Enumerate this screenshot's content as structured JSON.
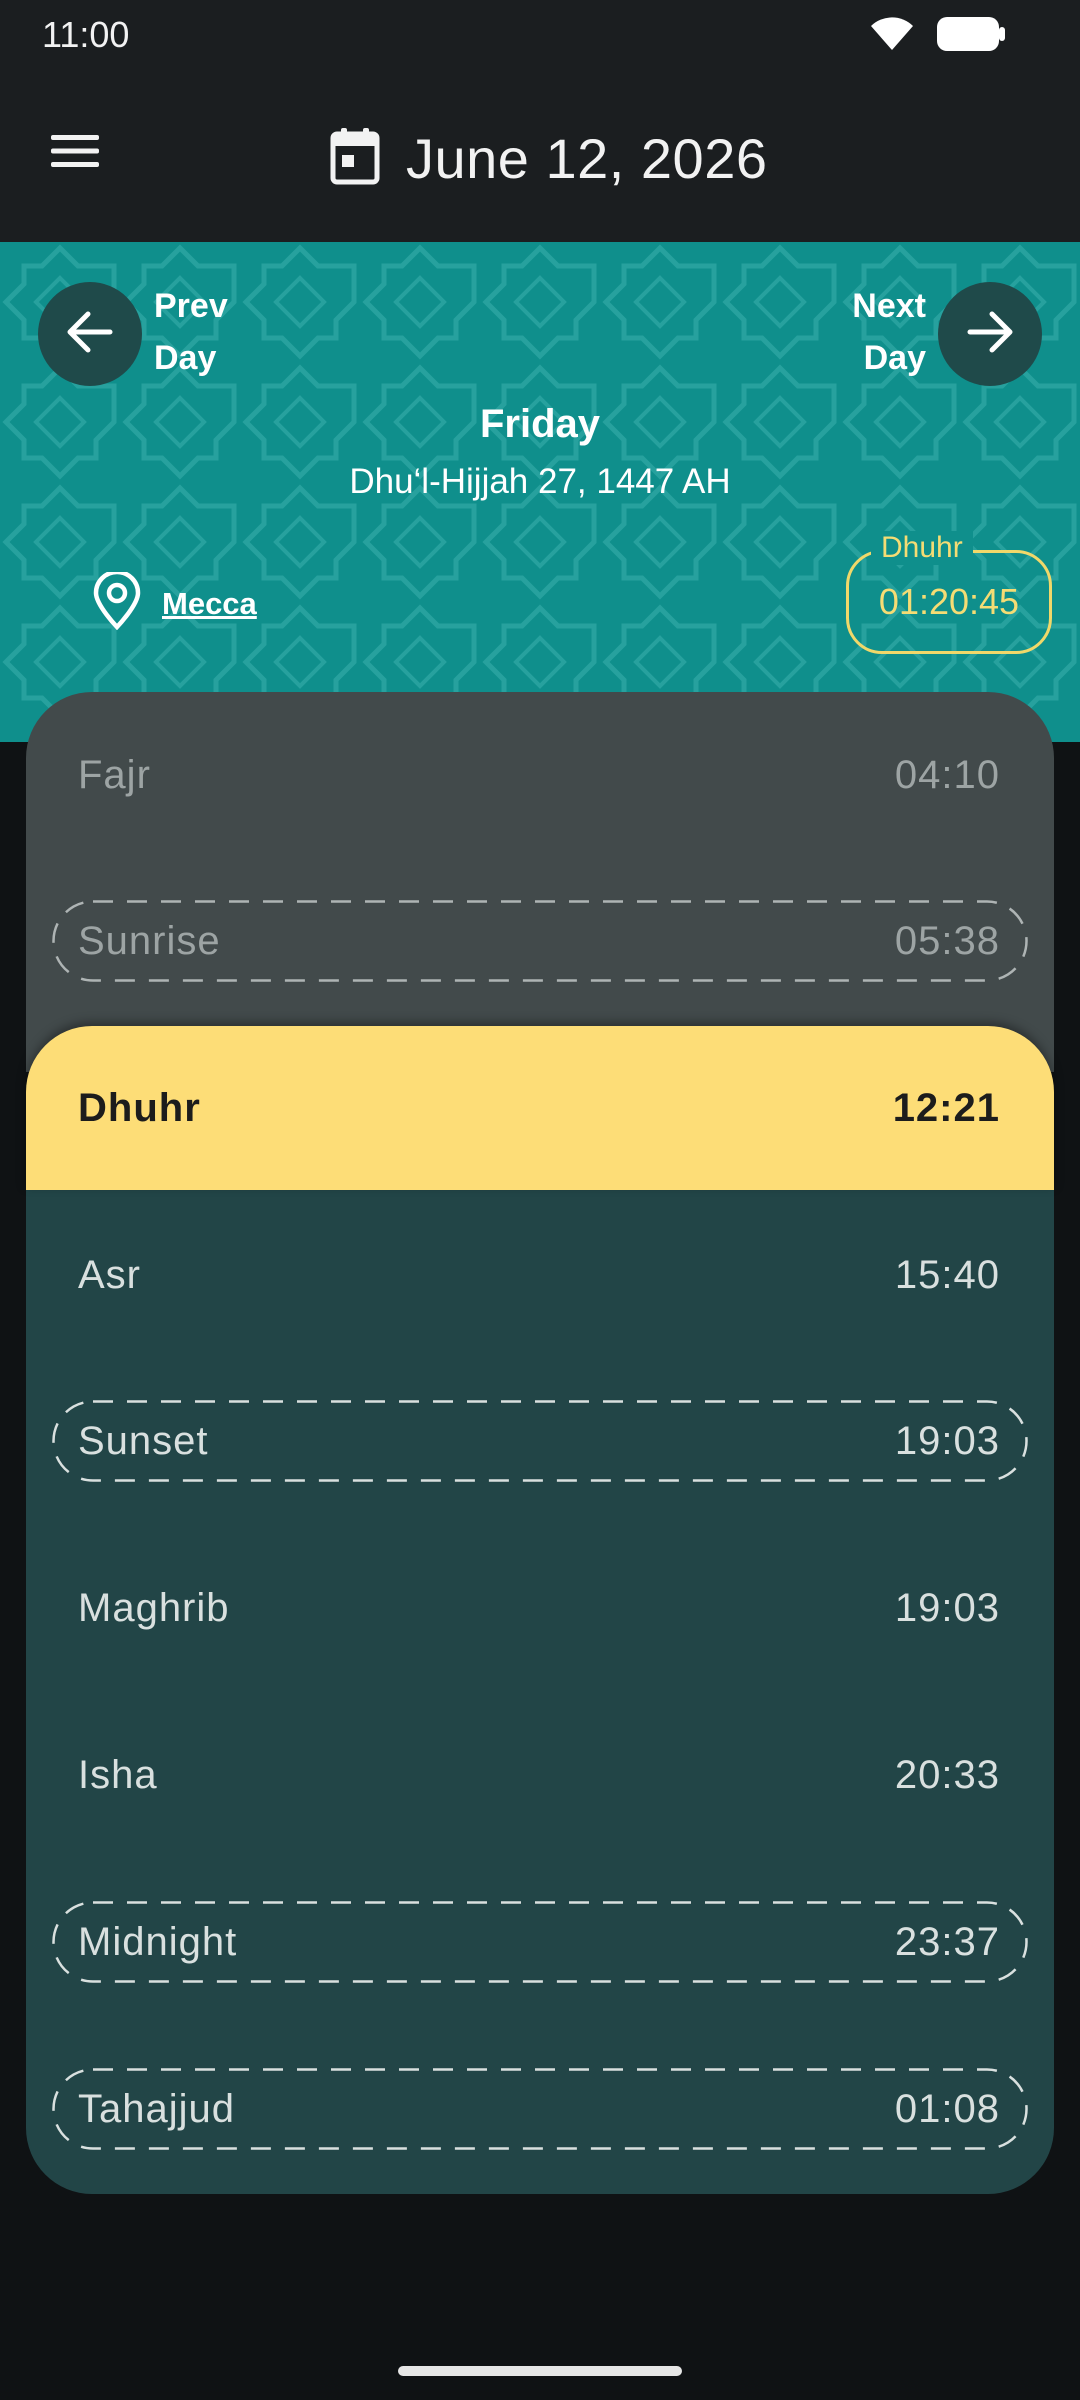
{
  "status_bar": {
    "time": "11:00",
    "icons": [
      "wifi-icon",
      "battery-icon"
    ]
  },
  "app_bar": {
    "menu_icon": "menu-icon",
    "calendar_icon": "calendar-icon",
    "date": "June 12, 2026"
  },
  "header": {
    "prev_label_line1": "Prev",
    "prev_label_line2": "Day",
    "next_label_line1": "Next",
    "next_label_line2": "Day",
    "weekday": "Friday",
    "hijri_date": "Dhu‘l-Hijjah 27, 1447 AH",
    "location": "Mecca",
    "countdown_label": "Dhuhr",
    "countdown_time": "01:20:45"
  },
  "prayers": [
    {
      "name": "Fajr",
      "time": "04:10",
      "state": "past",
      "optional": false
    },
    {
      "name": "Sunrise",
      "time": "05:38",
      "state": "past",
      "optional": true
    },
    {
      "name": "Dhuhr",
      "time": "12:21",
      "state": "current",
      "optional": false
    },
    {
      "name": "Asr",
      "time": "15:40",
      "state": "upcoming",
      "optional": false
    },
    {
      "name": "Sunset",
      "time": "19:03",
      "state": "upcoming",
      "optional": true
    },
    {
      "name": "Maghrib",
      "time": "19:03",
      "state": "upcoming",
      "optional": false
    },
    {
      "name": "Isha",
      "time": "20:33",
      "state": "upcoming",
      "optional": false
    },
    {
      "name": "Midnight",
      "time": "23:37",
      "state": "upcoming",
      "optional": true
    },
    {
      "name": "Tahajjud",
      "time": "01:08",
      "state": "upcoming",
      "optional": true
    }
  ],
  "colors": {
    "app_bar": "#1b1e20",
    "header_teal": "#0f8f8c",
    "past_card": "#424a4b",
    "current_highlight": "#fddd77",
    "upcoming_card": "#224547",
    "countdown_accent": "#f5dc74"
  }
}
